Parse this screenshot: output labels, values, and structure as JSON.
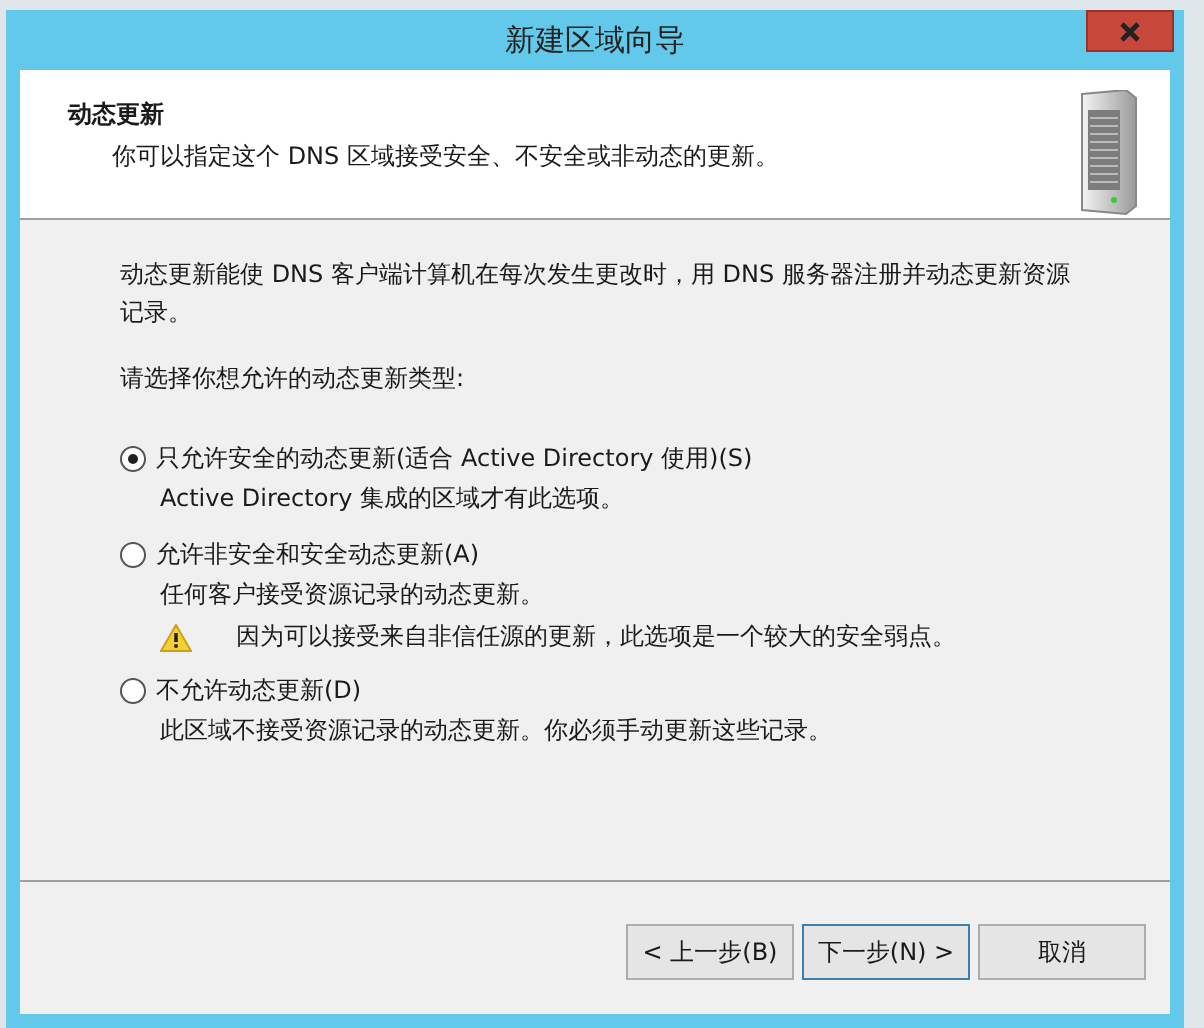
{
  "window": {
    "title": "新建区域向导"
  },
  "header": {
    "title": "动态更新",
    "subtitle": "你可以指定这个 DNS 区域接受安全、不安全或非动态的更新。"
  },
  "intro": "动态更新能使 DNS 客户端计算机在每次发生更改时，用 DNS 服务器注册并动态更新资源记录。",
  "prompt": "请选择你想允许的动态更新类型:",
  "options": [
    {
      "label": "只允许安全的动态更新(适合 Active Directory 使用)(S)",
      "selected": true,
      "description": "Active Directory 集成的区域才有此选项。"
    },
    {
      "label": "允许非安全和安全动态更新(A)",
      "selected": false,
      "description": "任何客户接受资源记录的动态更新。",
      "warning": "因为可以接受来自非信任源的更新，此选项是一个较大的安全弱点。"
    },
    {
      "label": "不允许动态更新(D)",
      "selected": false,
      "description": "此区域不接受资源记录的动态更新。你必须手动更新这些记录。"
    }
  ],
  "buttons": [
    {
      "label": "< 上一步(B)",
      "default": false
    },
    {
      "label": "下一步(N) >",
      "default": true
    },
    {
      "label": "取消",
      "default": false
    }
  ]
}
